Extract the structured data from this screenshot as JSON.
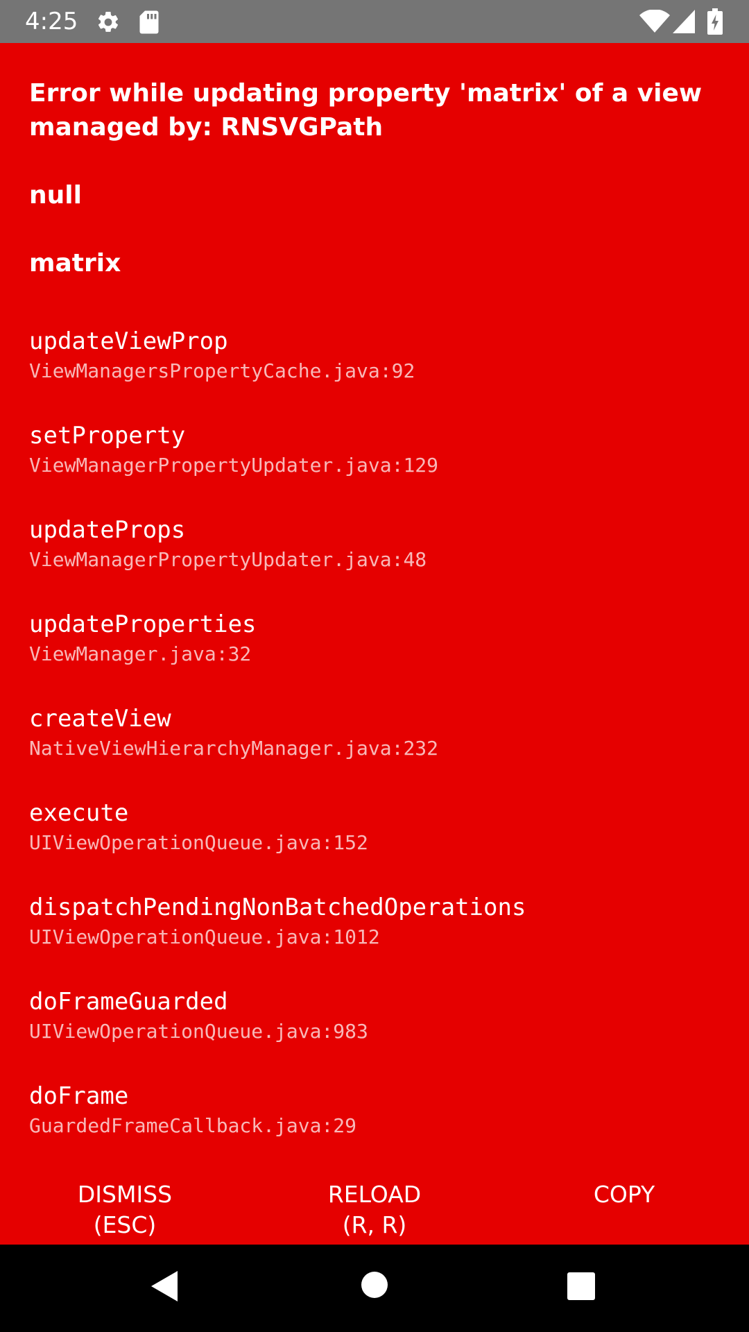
{
  "status_bar": {
    "time": "4:25",
    "icons": [
      "gear-icon",
      "sd-card-icon",
      "wifi-icon",
      "cell-signal-icon",
      "battery-charging-icon"
    ]
  },
  "error": {
    "lines": [
      "Error while updating property 'matrix' of a view",
      "managed by: RNSVGPath",
      "null",
      "matrix"
    ]
  },
  "stack": [
    {
      "method": "updateViewProp",
      "location": "ViewManagersPropertyCache.java:92"
    },
    {
      "method": "setProperty",
      "location": "ViewManagerPropertyUpdater.java:129"
    },
    {
      "method": "updateProps",
      "location": "ViewManagerPropertyUpdater.java:48"
    },
    {
      "method": "updateProperties",
      "location": "ViewManager.java:32"
    },
    {
      "method": "createView",
      "location": "NativeViewHierarchyManager.java:232"
    },
    {
      "method": "execute",
      "location": "UIViewOperationQueue.java:152"
    },
    {
      "method": "dispatchPendingNonBatchedOperations",
      "location": "UIViewOperationQueue.java:1012"
    },
    {
      "method": "doFrameGuarded",
      "location": "UIViewOperationQueue.java:983"
    },
    {
      "method": "doFrame",
      "location": "GuardedFrameCallback.java:29"
    }
  ],
  "buttons": {
    "dismiss": {
      "label": "DISMISS",
      "shortcut": "(ESC)"
    },
    "reload": {
      "label": "RELOAD",
      "shortcut": "(R, R)"
    },
    "copy": {
      "label": "COPY"
    }
  },
  "nav_bar": {
    "icons": [
      "back-icon",
      "home-icon",
      "recents-icon"
    ]
  },
  "colors": {
    "redbox_background": "#e50000",
    "status_bar": "#757575",
    "nav_bar": "#000000"
  }
}
